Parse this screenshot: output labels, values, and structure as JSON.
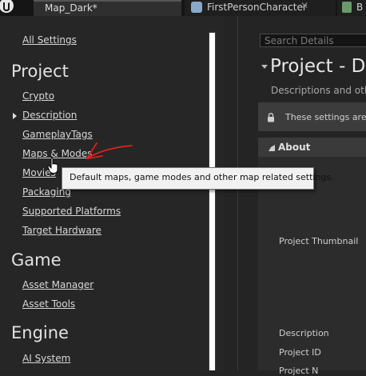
{
  "tabs": [
    {
      "label": "Map_Dark*",
      "active": true
    },
    {
      "label": "FirstPersonCharacter",
      "active": false
    },
    {
      "label": "B",
      "active": false
    }
  ],
  "sidebar": {
    "all_settings": "All Settings",
    "sections": [
      {
        "heading": "Project",
        "items": [
          "Crypto",
          "Description",
          "GameplayTags",
          "Maps & Modes",
          "Movies",
          "Packaging",
          "Supported Platforms",
          "Target Hardware"
        ]
      },
      {
        "heading": "Game",
        "items": [
          "Asset Manager",
          "Asset Tools"
        ]
      },
      {
        "heading": "Engine",
        "items": [
          "AI System"
        ]
      }
    ],
    "hovered_item": "Maps & Modes"
  },
  "tooltip": {
    "text": "Default maps, game modes and other map related settings."
  },
  "details": {
    "search_placeholder": "Search Details",
    "title": "Project - De",
    "description": "Descriptions and othe",
    "notice": "These settings are s",
    "section": "About",
    "properties": [
      "Project Thumbnail",
      "Description",
      "Project ID",
      "Project N"
    ]
  },
  "colors": {
    "annotation": "#e0201e",
    "background": "#242424",
    "tooltip_bg": "#f1f1f1"
  },
  "icons": {
    "tab2": "blueprint-icon",
    "tab3": "blueprint-icon",
    "notice": "lock-icon",
    "cursor": "hand-pointer-icon"
  }
}
